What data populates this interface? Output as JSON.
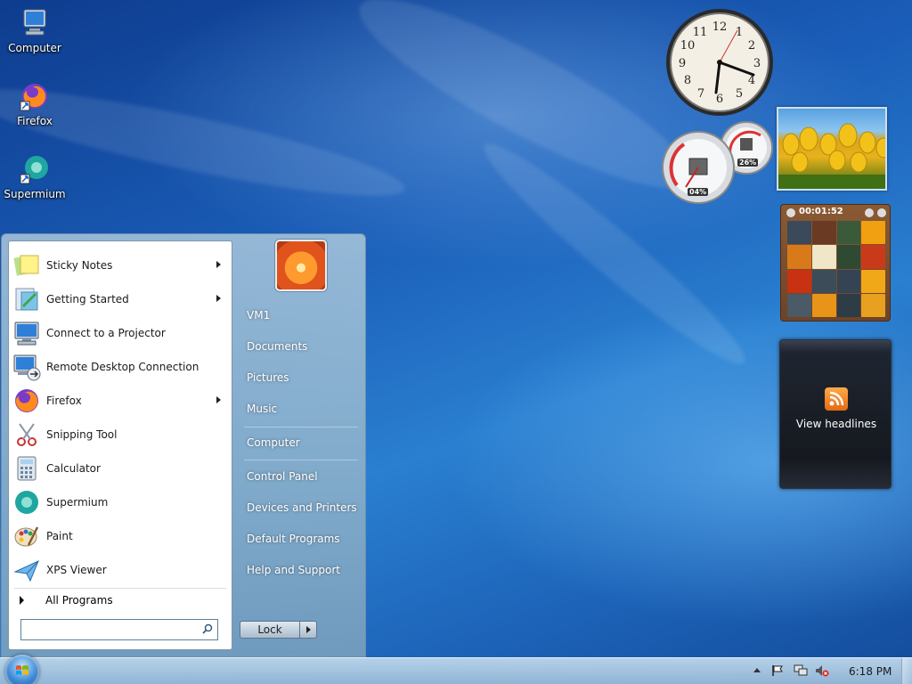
{
  "desktop": {
    "icons": [
      {
        "label": "Computer"
      },
      {
        "label": "Firefox"
      },
      {
        "label": "Supermium"
      }
    ]
  },
  "start_menu": {
    "programs": [
      {
        "label": "Sticky Notes",
        "icon": "sticky-notes-icon",
        "has_submenu": true
      },
      {
        "label": "Getting Started",
        "icon": "getting-started-icon",
        "has_submenu": true
      },
      {
        "label": "Connect to a Projector",
        "icon": "projector-icon",
        "has_submenu": false
      },
      {
        "label": "Remote Desktop Connection",
        "icon": "remote-desktop-icon",
        "has_submenu": false
      },
      {
        "label": "Firefox",
        "icon": "firefox-icon",
        "has_submenu": true
      },
      {
        "label": "Snipping Tool",
        "icon": "scissors-icon",
        "has_submenu": false
      },
      {
        "label": "Calculator",
        "icon": "calculator-icon",
        "has_submenu": false
      },
      {
        "label": "Supermium",
        "icon": "supermium-icon",
        "has_submenu": false
      },
      {
        "label": "Paint",
        "icon": "paint-palette-icon",
        "has_submenu": false
      },
      {
        "label": "XPS Viewer",
        "icon": "xps-viewer-icon",
        "has_submenu": false
      }
    ],
    "all_programs_label": "All Programs",
    "search": {
      "value": "",
      "placeholder": ""
    },
    "right_links": [
      {
        "label": "VM1"
      },
      {
        "label": "Documents"
      },
      {
        "label": "Pictures"
      },
      {
        "label": "Music"
      },
      {
        "label": "Computer"
      },
      {
        "label": "Control Panel"
      },
      {
        "label": "Devices and Printers"
      },
      {
        "label": "Default Programs"
      },
      {
        "label": "Help and Support"
      }
    ],
    "lock_label": "Lock"
  },
  "gadgets": {
    "meter": {
      "cpu": "04%",
      "memory": "26%"
    },
    "puzzle": {
      "time": "00:01:52"
    },
    "feed": {
      "label": "View headlines"
    }
  },
  "taskbar": {
    "time": "6:18 PM"
  },
  "colors": {
    "accent": "#1d64b9",
    "rss": "#f08a24"
  }
}
